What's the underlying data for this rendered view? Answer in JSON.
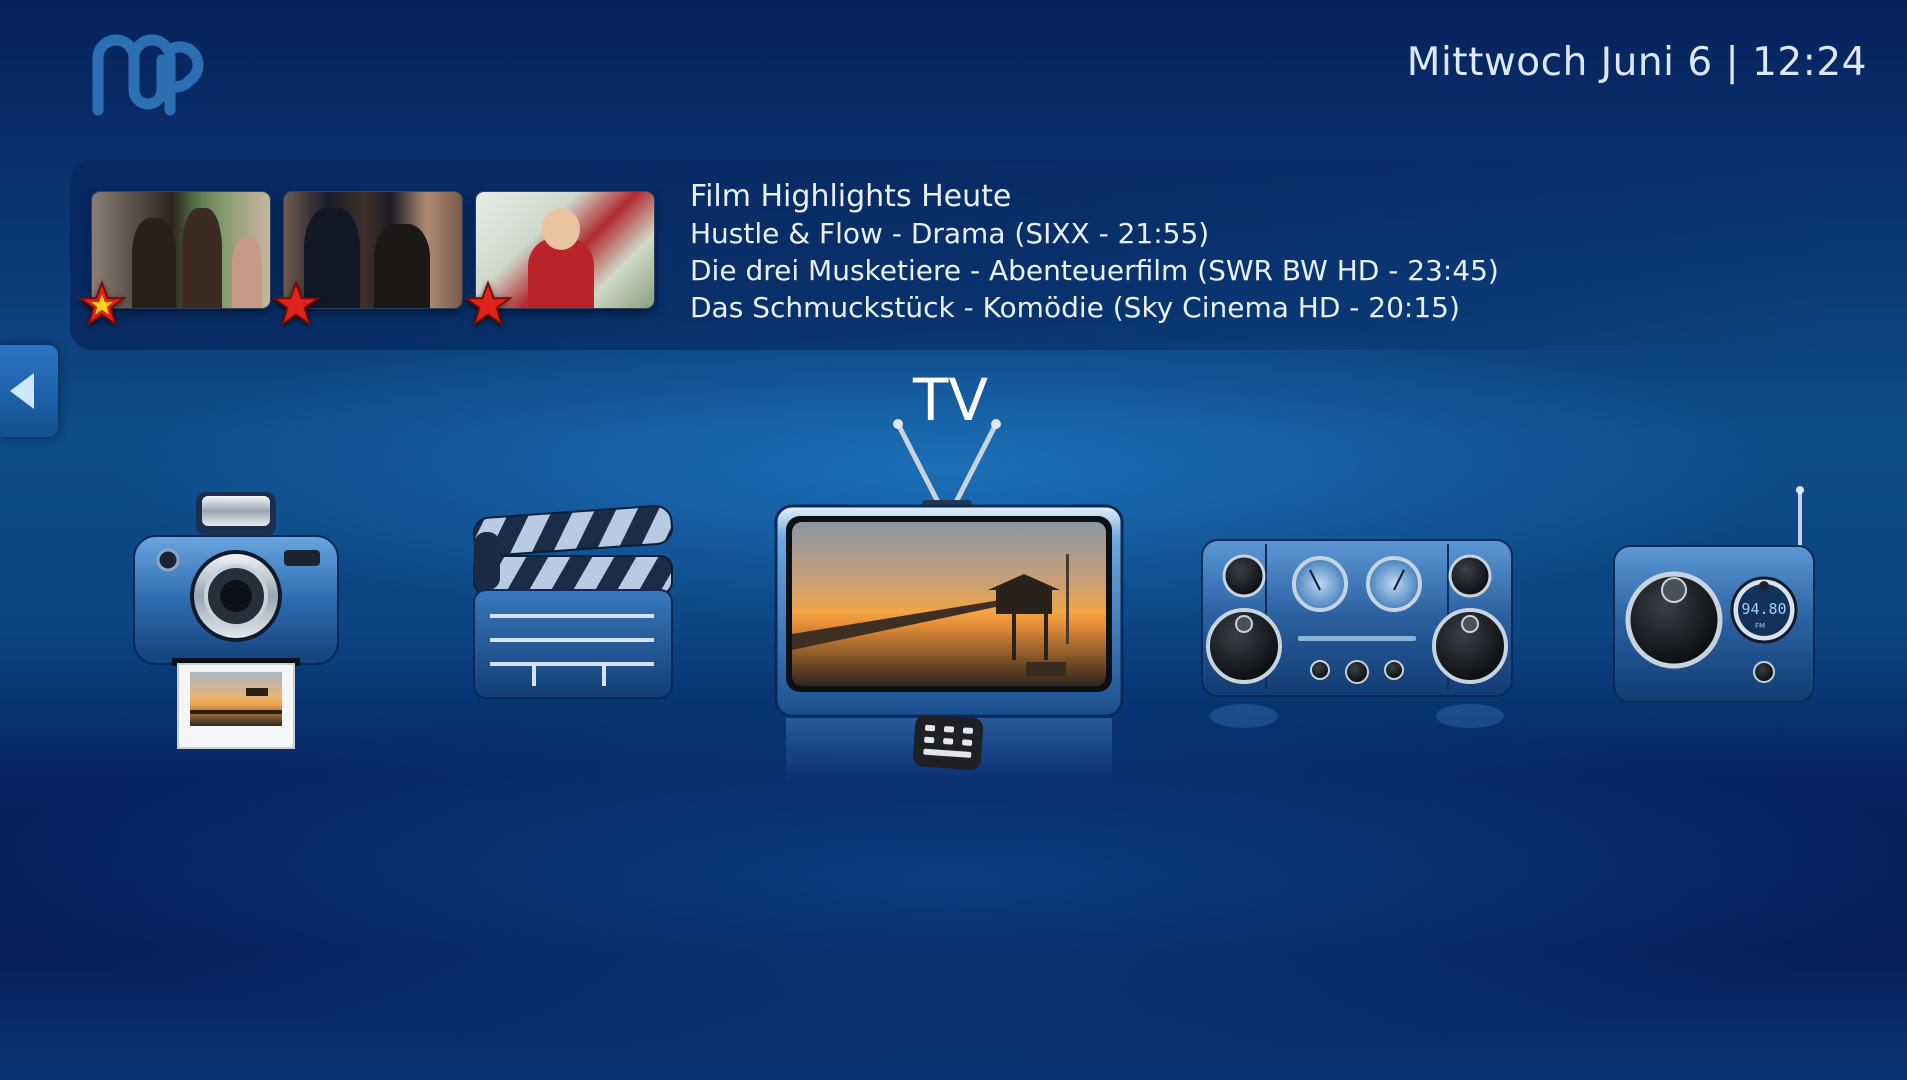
{
  "app": {
    "logo_icon": "mediaportal-logo-icon"
  },
  "clock": {
    "text": "Mittwoch Juni 6 | 12:24"
  },
  "highlights": {
    "title": "Film Highlights Heute",
    "items": [
      "Hustle & Flow - Drama (SIXX - 21:55)",
      "Die drei Musketiere - Abenteuerfilm (SWR BW HD - 23:45)",
      "Das Schmuckstück - Komödie (Sky Cinema HD - 20:15)"
    ]
  },
  "menu": {
    "selected_label": "TV",
    "items": [
      {
        "icon": "camera-icon"
      },
      {
        "icon": "clapperboard-icon"
      },
      {
        "icon": "tv-icon",
        "selected": true
      },
      {
        "icon": "stereo-icon"
      },
      {
        "icon": "radio-icon",
        "display_text": "94.80",
        "display_subtext": "FM"
      }
    ]
  },
  "nav": {
    "left_arrow_icon": "arrow-left-icon"
  },
  "colors": {
    "background_top": "#06235b",
    "background_band": "#0e4c8a",
    "text": "#e9f0ff",
    "accent": "#2a76c4",
    "star": "#e0231c"
  }
}
